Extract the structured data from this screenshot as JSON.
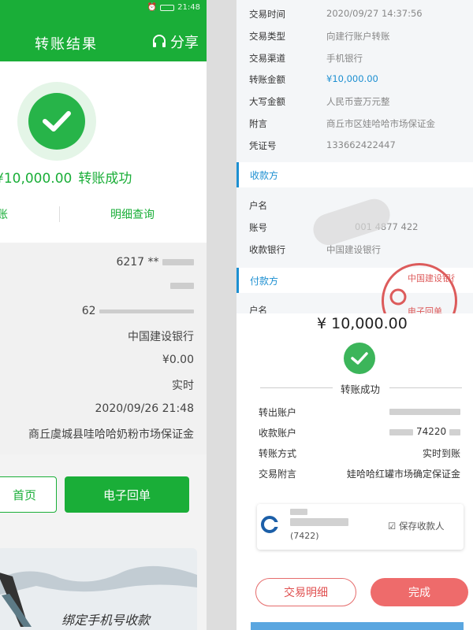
{
  "left": {
    "status_time": "21:48",
    "title": "转账结果",
    "share_label": "分享",
    "amount": "¥10,000.00",
    "status_text": "转账成功",
    "tab_left": "账",
    "tab_right": "明细查询",
    "details": [
      "6217 **",
      "",
      "62",
      "中国建设银行",
      "¥0.00",
      "实时",
      "2020/09/26 21:48",
      "商丘虞城县哇哈哈奶粉市场保证金"
    ],
    "btn_home": "首页",
    "btn_receipt": "电子回单",
    "banner_text": "绑定手机号收款"
  },
  "right_top": {
    "rows": [
      {
        "label": "交易时间",
        "value": "2020/09/27  14:37:56"
      },
      {
        "label": "交易类型",
        "value": "向建行账户转账"
      },
      {
        "label": "交易渠道",
        "value": "手机银行"
      },
      {
        "label": "转账金额",
        "value": "¥10,000.00"
      },
      {
        "label": "大写金额",
        "value": "人民币壹万元整"
      },
      {
        "label": "附言",
        "value": "商丘市区娃哈哈市场保证金"
      },
      {
        "label": "凭证号",
        "value": "133662422447"
      }
    ],
    "payee_section": "收款方",
    "payee_rows": [
      {
        "label": "户名",
        "value": ""
      },
      {
        "label": "账号",
        "value": "001 4877 422"
      },
      {
        "label": "收款银行",
        "value": "中国建设银行"
      }
    ],
    "payer_section": "付款方",
    "payer_rows": [
      {
        "label": "户名",
        "value": ""
      }
    ],
    "stamp_text": "中国建设银行",
    "stamp_sub": "电子回单"
  },
  "right_bottom": {
    "amount": "¥ 10,000.00",
    "status_text": "转账成功",
    "rows": [
      {
        "label": "转出账户",
        "value": ""
      },
      {
        "label": "收款账户",
        "value": "74220"
      },
      {
        "label": "转账方式",
        "value": "实时到账"
      },
      {
        "label": "交易附言",
        "value": "娃哈哈红罐市场确定保证金"
      }
    ],
    "card_account": "(7422)",
    "save_payee": "保存收款人",
    "btn_detail": "交易明细",
    "btn_done": "完成"
  },
  "colors": {
    "green": "#1aae38",
    "blue": "#1c8fd1",
    "red": "#ee6b6b"
  }
}
